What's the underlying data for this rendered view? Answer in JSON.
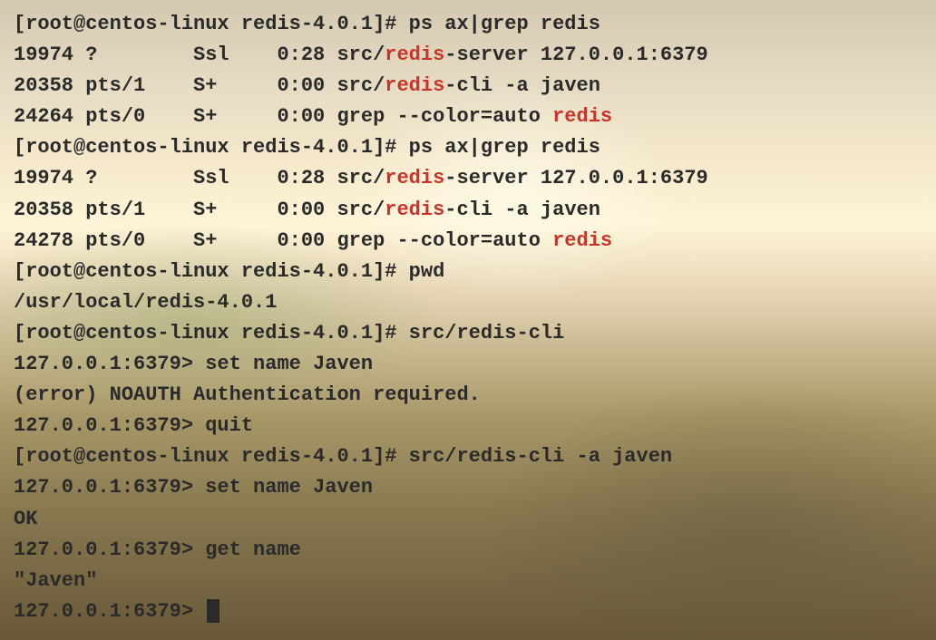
{
  "terminal": {
    "lines": [
      {
        "type": "plain",
        "text": "[root@centos-linux redis-4.0.1]# ps ax|grep redis"
      },
      {
        "type": "ps",
        "pre": "19974 ?        Ssl    0:28 src/",
        "hl": "redis",
        "post": "-server 127.0.0.1:6379"
      },
      {
        "type": "ps",
        "pre": "20358 pts/1    S+     0:00 src/",
        "hl": "redis",
        "post": "-cli -a javen"
      },
      {
        "type": "ps",
        "pre": "24264 pts/0    S+     0:00 grep --color=auto ",
        "hl": "redis",
        "post": ""
      },
      {
        "type": "plain",
        "text": "[root@centos-linux redis-4.0.1]# ps ax|grep redis"
      },
      {
        "type": "ps",
        "pre": "19974 ?        Ssl    0:28 src/",
        "hl": "redis",
        "post": "-server 127.0.0.1:6379"
      },
      {
        "type": "ps",
        "pre": "20358 pts/1    S+     0:00 src/",
        "hl": "redis",
        "post": "-cli -a javen"
      },
      {
        "type": "ps",
        "pre": "24278 pts/0    S+     0:00 grep --color=auto ",
        "hl": "redis",
        "post": ""
      },
      {
        "type": "plain",
        "text": "[root@centos-linux redis-4.0.1]# pwd"
      },
      {
        "type": "plain",
        "text": "/usr/local/redis-4.0.1"
      },
      {
        "type": "plain",
        "text": "[root@centos-linux redis-4.0.1]# src/redis-cli"
      },
      {
        "type": "plain",
        "text": "127.0.0.1:6379> set name Javen"
      },
      {
        "type": "plain",
        "text": "(error) NOAUTH Authentication required."
      },
      {
        "type": "plain",
        "text": "127.0.0.1:6379> quit"
      },
      {
        "type": "plain",
        "text": "[root@centos-linux redis-4.0.1]# src/redis-cli -a javen"
      },
      {
        "type": "plain",
        "text": "127.0.0.1:6379> set name Javen"
      },
      {
        "type": "plain",
        "text": "OK"
      },
      {
        "type": "plain",
        "text": "127.0.0.1:6379> get name"
      },
      {
        "type": "plain",
        "text": "\"Javen\""
      },
      {
        "type": "cursor",
        "text": "127.0.0.1:6379> "
      }
    ]
  }
}
